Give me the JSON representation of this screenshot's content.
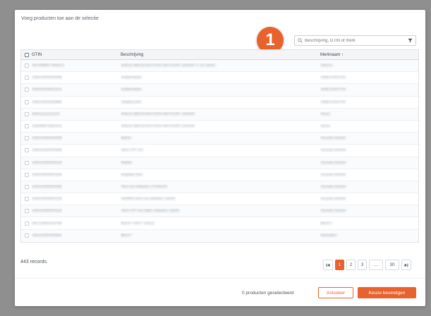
{
  "modal": {
    "title": "Voeg producten toe aan de selectie",
    "step_number": "1"
  },
  "search": {
    "placeholder": "Beschrijving, GTIN of merk",
    "value": ""
  },
  "icons": {
    "search": "search-icon",
    "filter": "filter-icon",
    "sort_up": "arrow-up-icon",
    "first_page": "first-page-icon",
    "last_page": "last-page-icon"
  },
  "colors": {
    "accent": "#e8622d",
    "header_bg": "#f3f5f7",
    "backdrop": "#8f8f8f"
  },
  "table": {
    "columns": {
      "gtin": "GTIN",
      "description": "Beschrijving",
      "brand": "Merknaam",
      "brand_sort": "↑"
    },
    "rows": [
      {
        "gtin": "04789897783472",
        "description": "ANCO BESCHUITEN NATUUR 125GR X 10 stuks",
        "brand": "ANCO"
      },
      {
        "gtin": "2541000000946",
        "description": "Suikerwerk",
        "brand": "ANEUVAUTE"
      },
      {
        "gtin": "5000000401522",
        "description": "Suikerwerk",
        "brand": "ANEUVAUTE"
      },
      {
        "gtin": "2541000000860",
        "description": "Totalvrucht",
        "brand": "ANEUVAUTE"
      },
      {
        "gtin": "4001111111207",
        "description": "ANCO BESCHUITEN NATUUR 125GR",
        "brand": "Anco"
      },
      {
        "gtin": "3184867840101",
        "description": "ANCO BESCHUITEN NATUUR 125GR",
        "brand": "Anco"
      },
      {
        "gtin": "2541000000408",
        "description": "demo",
        "brand": "Acuras brand"
      },
      {
        "gtin": "2541000000344",
        "description": "Test ITP UA",
        "brand": "Acuras brand"
      },
      {
        "gtin": "2541000000215",
        "description": "Netter",
        "brand": "Acuras brand"
      },
      {
        "gtin": "2541000000184",
        "description": "Display test",
        "brand": "Acuras brand"
      },
      {
        "gtin": "2541000000165",
        "description": "Test na release 27/05/19",
        "brand": "Acuras brand"
      },
      {
        "gtin": "2541000000125",
        "description": "ADMIN test na release 15/05",
        "brand": "Acuras brand"
      },
      {
        "gtin": "2541000000118",
        "description": "Test ITP UA after release 15/05",
        "brand": "Acuras brand"
      },
      {
        "gtin": "0871000014784",
        "description": "BOXY NOT SALE",
        "brand": "BOXY"
      },
      {
        "gtin": "2541000000851",
        "description": "BEST",
        "brand": "Ekhuden"
      }
    ]
  },
  "records_label": "443 records",
  "pagination": {
    "first": "⏮",
    "pages": [
      "1",
      "2",
      "3",
      "...",
      "30"
    ],
    "last": "⏭",
    "current": "1"
  },
  "footer": {
    "selected_text": "0 producten geselecteerd",
    "cancel_label": "Annuleer",
    "confirm_label": "Keuze bevestigen"
  }
}
